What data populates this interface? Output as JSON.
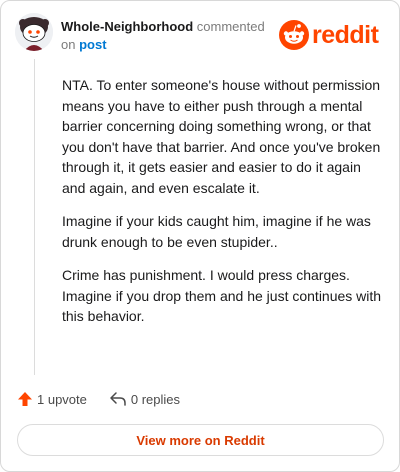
{
  "comment": {
    "author": "Whole-Neighborhood",
    "action_text": "commented on",
    "post_link_label": "post",
    "paragraphs": [
      "NTA. To enter someone's house without permission means you have to either push through a mental barrier concerning doing something wrong, or that you don't have that barrier. And once you've broken through it, it gets easier and easier to do it again and again, and even escalate it.",
      "Imagine if your kids caught him, imagine if he was drunk enough to be even stupider..",
      "Crime has punishment. I would press charges. Imagine if you drop them and he just continues with this behavior."
    ]
  },
  "brand": {
    "name": "reddit",
    "color": "#ff4500"
  },
  "actions": {
    "upvote_label": "1 upvote",
    "replies_label": "0 replies"
  },
  "footer": {
    "view_more_label": "View more on Reddit"
  },
  "colors": {
    "accent": "#ff4500",
    "link": "#0079d3",
    "view_more_text": "#d93a00"
  },
  "icons": {
    "avatar": "snoo-avatar-icon",
    "logo": "reddit-snoo-icon",
    "upvote": "upvote-arrow-icon",
    "reply": "reply-arrow-icon"
  }
}
